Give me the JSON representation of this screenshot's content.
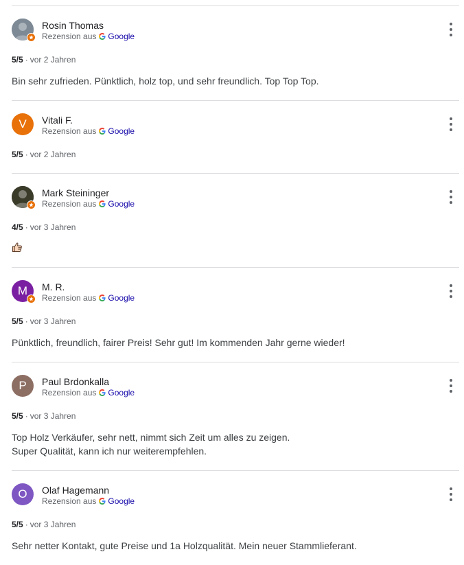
{
  "source_prefix": "Rezension aus",
  "source_name": "Google",
  "reviews": [
    {
      "name": "Rosin Thomas",
      "avatar_type": "photo",
      "avatar_color": "#7d8a96",
      "local_guide": true,
      "rating": "5/5",
      "date": "vor 2 Jahren",
      "text_lines": [
        "Bin sehr zufrieden. Pünktlich, holz top, und sehr freundlich. Top Top Top."
      ]
    },
    {
      "name": "Vitali F.",
      "avatar_type": "letter",
      "avatar_letter": "V",
      "avatar_color": "#e8710a",
      "local_guide": false,
      "rating": "5/5",
      "date": "vor 2 Jahren",
      "text_lines": []
    },
    {
      "name": "Mark Steininger",
      "avatar_type": "photo",
      "avatar_color": "#3b3b2a",
      "local_guide": true,
      "rating": "4/5",
      "date": "vor 3 Jahren",
      "text_lines": [],
      "emoji": "thumbs-up-icon"
    },
    {
      "name": "M. R.",
      "avatar_type": "letter",
      "avatar_letter": "M",
      "avatar_color": "#7b1fa2",
      "local_guide": true,
      "rating": "5/5",
      "date": "vor 3 Jahren",
      "text_lines": [
        "Pünktlich, freundlich, fairer Preis! Sehr gut! Im kommenden Jahr gerne wieder!"
      ]
    },
    {
      "name": "Paul Brdonkalla",
      "avatar_type": "letter",
      "avatar_letter": "P",
      "avatar_color": "#8d6e63",
      "local_guide": false,
      "rating": "5/5",
      "date": "vor 3 Jahren",
      "text_lines": [
        "Top Holz Verkäufer, sehr nett, nimmt sich Zeit um alles zu zeigen.",
        "Super Qualität, kann ich nur weiterempfehlen."
      ]
    },
    {
      "name": "Olaf Hagemann",
      "avatar_type": "letter",
      "avatar_letter": "O",
      "avatar_color": "#7e57c2",
      "local_guide": false,
      "rating": "5/5",
      "date": "vor 3 Jahren",
      "text_lines": [
        "Sehr netter Kontakt, gute Preise und 1a Holzqualität. Mein neuer Stammlieferant."
      ]
    }
  ]
}
